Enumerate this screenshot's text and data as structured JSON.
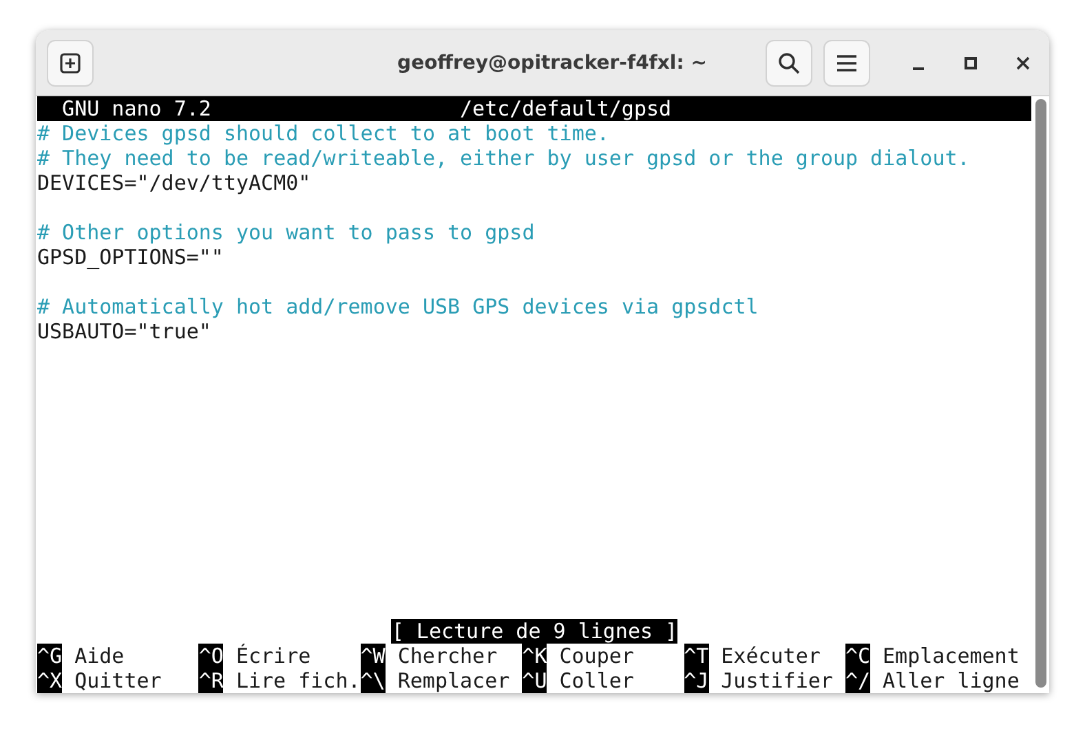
{
  "window": {
    "title": "geoffrey@opitracker-f4fxl: ~"
  },
  "editor": {
    "version": "GNU nano 7.2",
    "file": "/etc/default/gpsd",
    "lines": [
      {
        "kind": "comment",
        "text": "# Devices gpsd should collect to at boot time."
      },
      {
        "kind": "comment",
        "text": "# They need to be read/writeable, either by user gpsd or the group dialout."
      },
      {
        "kind": "code",
        "text": "DEVICES=\"/dev/ttyACM0\""
      },
      {
        "kind": "blank"
      },
      {
        "kind": "comment",
        "text": "# Other options you want to pass to gpsd"
      },
      {
        "kind": "code",
        "text": "GPSD_OPTIONS=\"\""
      },
      {
        "kind": "blank"
      },
      {
        "kind": "comment",
        "text": "# Automatically hot add/remove USB GPS devices via gpsdctl"
      },
      {
        "kind": "code",
        "text": "USBAUTO=\"true\""
      }
    ],
    "status": "[ Lecture de 9 lignes ]",
    "shortcuts": [
      [
        {
          "key": "^G",
          "label": "Aide"
        },
        {
          "key": "^O",
          "label": "Écrire"
        },
        {
          "key": "^W",
          "label": "Chercher"
        },
        {
          "key": "^K",
          "label": "Couper"
        },
        {
          "key": "^T",
          "label": "Exécuter"
        },
        {
          "key": "^C",
          "label": "Emplacement"
        }
      ],
      [
        {
          "key": "^X",
          "label": "Quitter"
        },
        {
          "key": "^R",
          "label": "Lire fich."
        },
        {
          "key": "^\\",
          "label": "Remplacer"
        },
        {
          "key": "^U",
          "label": "Coller"
        },
        {
          "key": "^J",
          "label": "Justifier"
        },
        {
          "key": "^/",
          "label": "Aller ligne"
        }
      ]
    ]
  }
}
